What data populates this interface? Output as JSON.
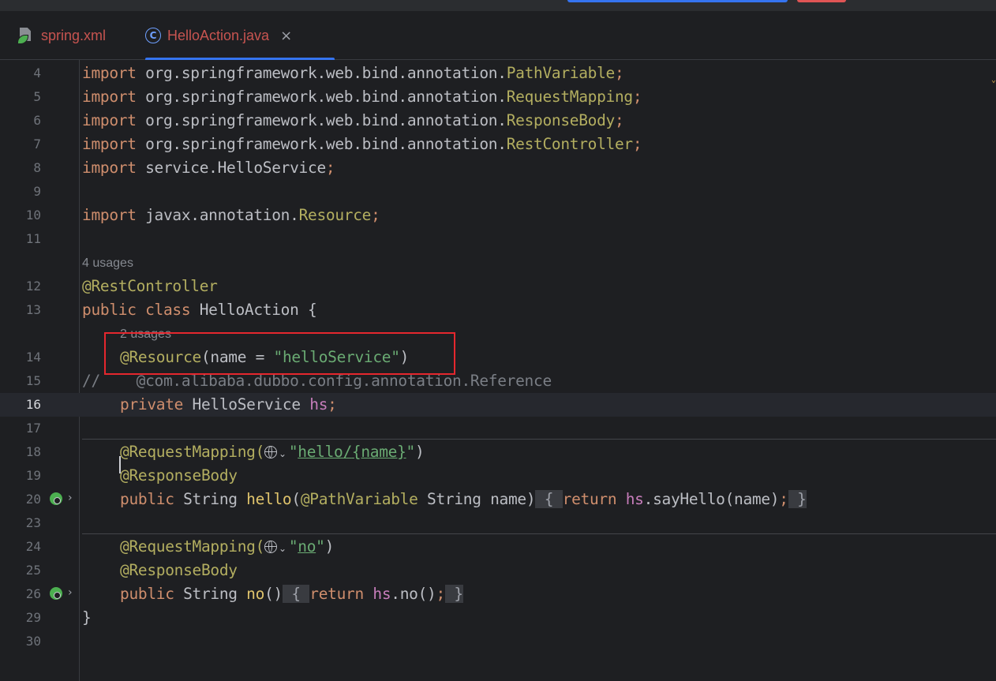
{
  "tabs": [
    {
      "label": "spring.xml",
      "icon": "spring-xml-file-icon"
    },
    {
      "label": "HelloAction.java",
      "icon": "java-class-icon",
      "active": true,
      "close": "×"
    }
  ],
  "editor": {
    "ln": {
      "l4": "4",
      "l5": "5",
      "l6": "6",
      "l7": "7",
      "l8": "8",
      "l9": "9",
      "l10": "10",
      "l11": "11",
      "l12": "12",
      "l13": "13",
      "l14": "14",
      "l15": "15",
      "l16": "16",
      "l17": "17",
      "l18": "18",
      "l19": "19",
      "l20": "20",
      "l23": "23",
      "l24": "24",
      "l25": "25",
      "l26": "26",
      "l29": "29",
      "l30": "30"
    },
    "hints": {
      "class_usages": "4 usages",
      "field_usages": "2 usages"
    },
    "t": {
      "import": "import",
      "pkg_web": " org.springframework.web.bind.annotation.",
      "PathVariable": "PathVariable",
      "RequestMapping": "RequestMapping",
      "ResponseBody": "ResponseBody",
      "RestController": "RestController",
      "semi": ";",
      "pkg_service": " service.HelloService",
      "pkg_javax": " javax.annotation.",
      "Resource": "Resource",
      "at_rest": "@RestController",
      "public": "public",
      "class": " class",
      "class_decl": " HelloAction {",
      "at_resource": "@Resource",
      "name_eq": "(name = ",
      "hello_service_str": "\"helloService\"",
      "close_paren": ")",
      "comment": "//    @com.alibaba.dubbo.config.annotation.Reference",
      "private": "private",
      "type_hs": " HelloService ",
      "hs": "hs",
      "at_reqmap": "@RequestMapping(",
      "chev": "⌄",
      "quote": "\"",
      "path_hello_a": "hello/",
      "path_hello_b": "{name}",
      "path_no": "no",
      "at_respbody": "@ResponseBody",
      "string_type": " String ",
      "hello": "hello",
      "open_paren": "(",
      "at_pathvar": "@PathVariable",
      "param": " String name)",
      "lbrace": " { ",
      "return": "return",
      "space": " ",
      "dot": ".",
      "sayHello": "sayHello",
      "args_name": "(name)",
      "rbrace": " }",
      "no": "no",
      "empty_parens": "()",
      "close_class": "}"
    }
  }
}
